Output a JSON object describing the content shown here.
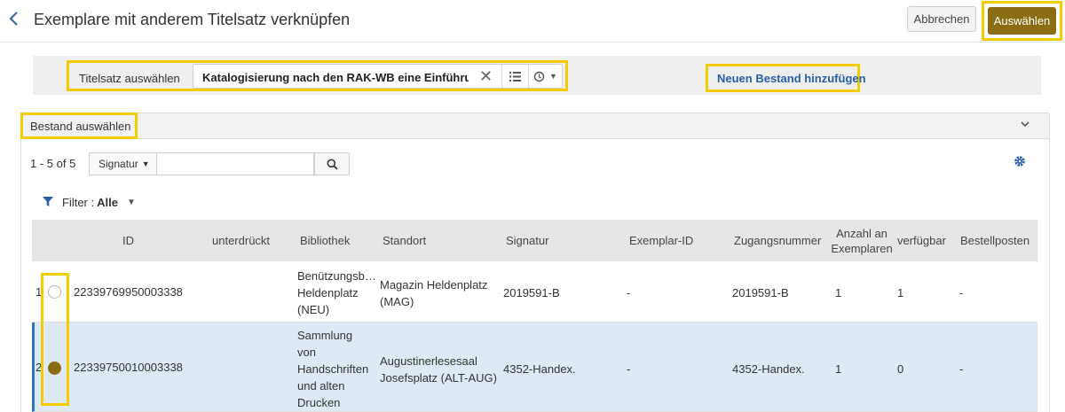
{
  "header": {
    "title": "Exemplare mit anderem Titelsatz verknüpfen",
    "cancel_label": "Abbrechen",
    "select_label": "Auswählen"
  },
  "record": {
    "label": "Titelsatz auswählen",
    "value": "Katalogisierung nach den RAK-WB eine Einführung in",
    "new_holding_label": "Neuen Bestand hinzufügen"
  },
  "section": {
    "title": "Bestand auswählen",
    "count": "1 - 5 of 5",
    "search_field": "Signatur",
    "search_value": "",
    "filter_label": "Filter :",
    "filter_value": "Alle"
  },
  "table": {
    "columns": [
      "ID",
      "unterdrückt",
      "Bibliothek",
      "Standort",
      "Signatur",
      "Exemplar-ID",
      "Zugangsnummer",
      "Anzahl an Exemplaren",
      "verfügbar",
      "Bestellposten"
    ],
    "rows": [
      {
        "num": "1",
        "selected": false,
        "id": "22339769950003338",
        "suppressed": "",
        "library": "Benützungsb… Heldenplatz (NEU)",
        "location": "Magazin Heldenplatz (MAG)",
        "call_number": "2019591-B",
        "item_id": "-",
        "accession": "2019591-B",
        "copies": "1",
        "available": "1",
        "po_line": "-"
      },
      {
        "num": "2",
        "selected": true,
        "id": "22339750010003338",
        "suppressed": "",
        "library": "Sammlung von Handschriften und alten Drucken (ALT)",
        "location": "Augustinerlesesaal Josefsplatz (ALT-AUG)",
        "call_number": "4352-Handex.",
        "item_id": "-",
        "accession": "4352-Handex.",
        "copies": "1",
        "available": "0",
        "po_line": "-"
      }
    ]
  },
  "colors": {
    "primary": "#8a6d12",
    "link": "#2a5ea8",
    "highlight": "#f4cc00",
    "selected_row": "#ddeaf6"
  },
  "icons": [
    "back-chevron-icon",
    "clear-icon",
    "list-icon",
    "history-icon",
    "search-icon",
    "gear-icon",
    "filter-icon",
    "chevron-down-icon"
  ]
}
